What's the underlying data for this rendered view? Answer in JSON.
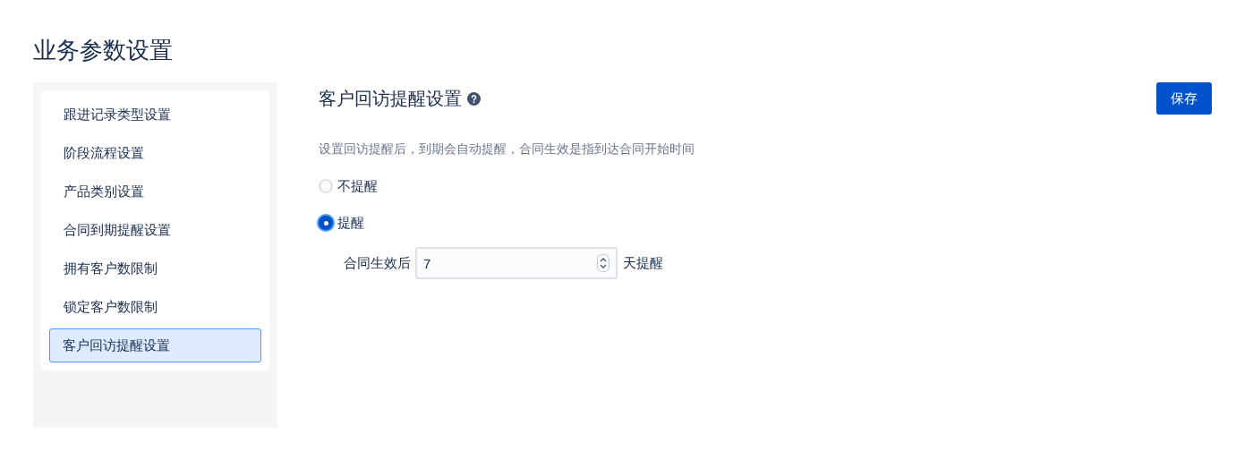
{
  "page_title": "业务参数设置",
  "sidebar": {
    "items": [
      {
        "label": "跟进记录类型设置",
        "selected": false
      },
      {
        "label": "阶段流程设置",
        "selected": false
      },
      {
        "label": "产品类别设置",
        "selected": false
      },
      {
        "label": "合同到期提醒设置",
        "selected": false
      },
      {
        "label": "拥有客户数限制",
        "selected": false
      },
      {
        "label": "锁定客户数限制",
        "selected": false
      },
      {
        "label": "客户回访提醒设置",
        "selected": true
      }
    ]
  },
  "section": {
    "title": "客户回访提醒设置",
    "save_button": "保存",
    "description": "设置回访提醒后，到期会自动提醒，合同生效是指到达合同开始时间",
    "options": [
      {
        "label": "不提醒",
        "selected": false
      },
      {
        "label": "提醒",
        "selected": true
      }
    ],
    "days_field": {
      "prefix": "合同生效后",
      "value": "7",
      "suffix": "天提醒"
    }
  }
}
